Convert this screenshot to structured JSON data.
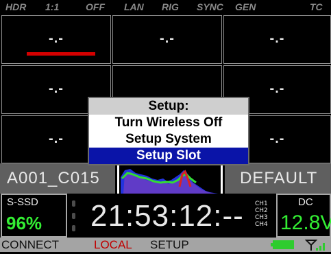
{
  "top_bar": {
    "items": [
      "HDR",
      "1:1",
      "OFF",
      "LAN",
      "RIG",
      "SYNC",
      "GEN",
      "TC"
    ]
  },
  "grid": {
    "cells": [
      "-.-",
      "-.-",
      "-.-",
      "-.-",
      "",
      "-.-",
      "-.-",
      "",
      "-.-"
    ]
  },
  "dialog": {
    "title": "Setup:",
    "options": [
      "Turn Wireless Off",
      "Setup System",
      "Setup Slot"
    ],
    "selected_index": 2
  },
  "clip_row": {
    "clip_name": "A001_C015",
    "look": "DEFAULT"
  },
  "info_row": {
    "media_label": "S-SSD",
    "media_percent": "96%",
    "timecode": "21:53:12:--",
    "channels": [
      "CH1",
      "CH2",
      "CH3",
      "CH4"
    ],
    "power_label": "DC",
    "voltage": "12.8V"
  },
  "soft_keys": {
    "connect": "CONNECT",
    "local": "LOCAL",
    "setup": "SETUP"
  },
  "status_icons": {
    "battery": "battery-icon",
    "signal": "antenna-signal-icon"
  },
  "colors": {
    "selected": "#0a14a8",
    "green": "#33ee33",
    "red": "#d40000"
  }
}
